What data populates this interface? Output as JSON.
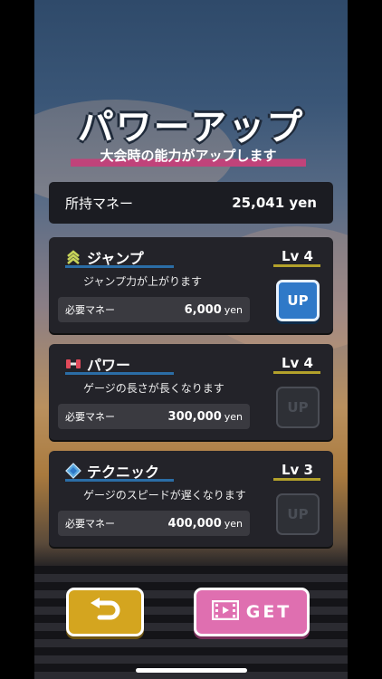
{
  "header": {
    "title": "パワーアップ",
    "subtitle": "大会時の能力がアップします"
  },
  "money": {
    "label": "所持マネー",
    "value": "25,041 yen"
  },
  "cost_label": "必要マネー",
  "unit": "yen",
  "cards": [
    {
      "name": "ジャンプ",
      "icon": "chevrons-up-icon",
      "level": "Lv 4",
      "desc": "ジャンプ力が上がります",
      "cost": "6,000",
      "button": "UP",
      "button_state": "active"
    },
    {
      "name": "パワー",
      "icon": "dumbbell-icon",
      "level": "Lv 4",
      "desc": "ゲージの長さが長くなります",
      "cost": "300,000",
      "button": "UP",
      "button_state": "disabled"
    },
    {
      "name": "テクニック",
      "icon": "diamond-icon",
      "level": "Lv 3",
      "desc": "ゲージのスピードが遅くなります",
      "cost": "400,000",
      "button": "UP",
      "button_state": "disabled"
    }
  ],
  "footer": {
    "back_icon": "back-arrow-icon",
    "get_label": "GET",
    "get_icon": "film-icon"
  },
  "colors": {
    "active_up": "#2f79c8",
    "back_button": "#d4a51f",
    "get_button": "#df6fb0",
    "subtitle_highlight": "#c0437a"
  }
}
